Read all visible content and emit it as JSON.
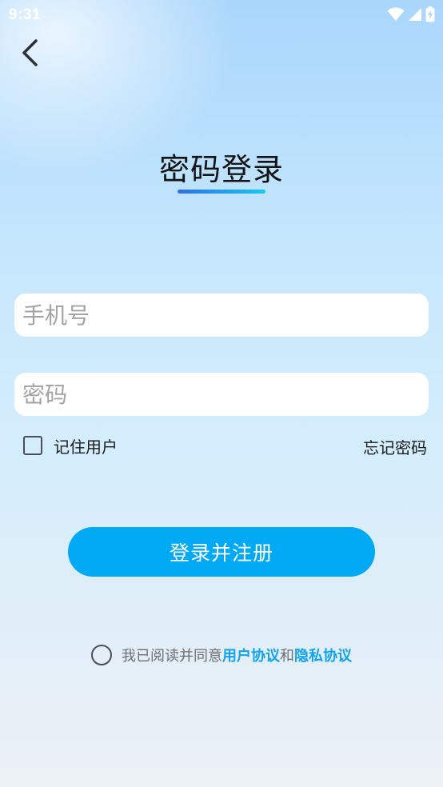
{
  "status_bar": {
    "time": "9:31",
    "icons": [
      "wifi-icon",
      "signal-icon",
      "battery-charging-icon"
    ]
  },
  "header": {
    "back_icon": "chevron-left-icon",
    "title": "密码登录"
  },
  "form": {
    "phone_placeholder": "手机号",
    "password_placeholder": "密码",
    "remember_label": "记住用户",
    "remember_checked": false,
    "forgot_label": "忘记密码",
    "submit_label": "登录并注册"
  },
  "agreement": {
    "checked": false,
    "prefix": "我已阅读并同意",
    "user_agreement": "用户协议",
    "and": "和",
    "privacy_policy": "隐私协议"
  },
  "colors": {
    "accent": "#02aaf6",
    "link": "#12a3ee",
    "title_underline_start": "#2f6fe6",
    "title_underline_end": "#19c7f4"
  }
}
